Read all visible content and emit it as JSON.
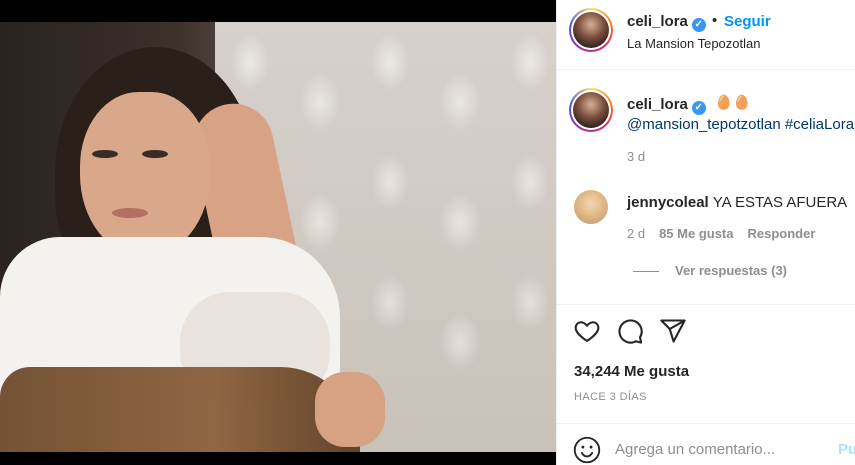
{
  "header": {
    "username": "celi_lora",
    "separator": "•",
    "follow_label": "Seguir",
    "location": "La Mansion Tepozotlan"
  },
  "caption": {
    "username": "celi_lora",
    "emoji": "🥚🥚",
    "tags": "@mansion_tepotzotlan #celiaLora",
    "time": "3 d"
  },
  "comment": {
    "username": "jennycoleal",
    "text": "YA ESTAS AFUERA",
    "time": "2 d",
    "likes": "85 Me gusta",
    "reply_label": "Responder",
    "view_replies": "Ver respuestas (3)"
  },
  "actions": {
    "likes": "34,244 Me gusta",
    "ago": "HACE 3 DÍAS"
  },
  "composer": {
    "placeholder": "Agrega un comentario...",
    "post_label": "Pu"
  },
  "icons": [
    "verified-badge-icon",
    "heart-icon",
    "comment-icon",
    "share-icon",
    "emoji-icon"
  ],
  "colors": {
    "link": "#0095f6",
    "hashtag": "#00376b",
    "muted": "#8e8e8e"
  }
}
